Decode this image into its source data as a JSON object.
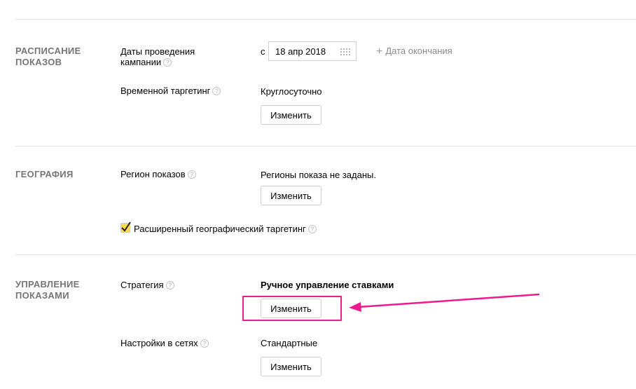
{
  "sections": {
    "schedule": {
      "title": "РАСПИСАНИЕ ПОКАЗОВ",
      "dates_label": "Даты проведения кампании",
      "date_prefix": "с",
      "start_date": "18 апр 2018",
      "end_date_link": "Дата окончания",
      "time_targeting_label": "Временной таргетинг",
      "time_targeting_value": "Круглосуточно",
      "change_button": "Изменить"
    },
    "geography": {
      "title": "ГЕОГРАФИЯ",
      "region_label": "Регион показов",
      "region_value": "Регионы показа не заданы.",
      "change_button": "Изменить",
      "extended_geo_label": "Расширенный географический таргетинг",
      "extended_geo_checked": true
    },
    "management": {
      "title": "УПРАВЛЕНИЕ ПОКАЗАМИ",
      "strategy_label": "Стратегия",
      "strategy_value": "Ручное управление ставками",
      "strategy_change_button": "Изменить",
      "networks_label": "Настройки в сетях",
      "networks_value": "Стандартные",
      "networks_change_button": "Изменить"
    }
  },
  "help_glyph": "?",
  "colors": {
    "highlight": "#ee1a8f",
    "checkbox": "#ffdb4d",
    "section_title": "#757575"
  }
}
